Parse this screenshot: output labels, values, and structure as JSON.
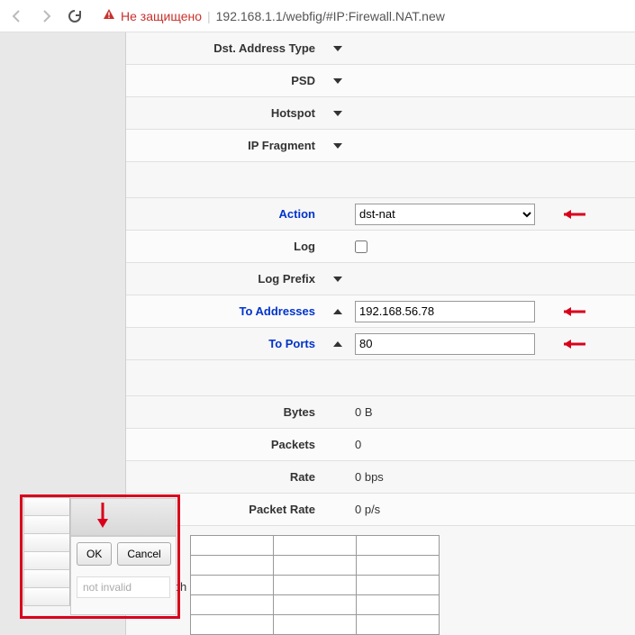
{
  "browser": {
    "security_text": "Не защищено",
    "url": "192.168.1.1/webfig/#IP:Firewall.NAT.new"
  },
  "rows": {
    "dst_addr_type": "Dst. Address Type",
    "psd": "PSD",
    "hotspot": "Hotspot",
    "ip_fragment": "IP Fragment",
    "action": "Action",
    "log": "Log",
    "log_prefix": "Log Prefix",
    "to_addresses": "To Addresses",
    "to_ports": "To Ports",
    "bytes": "Bytes",
    "packets": "Packets",
    "rate": "Rate",
    "packet_rate": "Packet Rate",
    "rate_graph": "Rate Graph"
  },
  "values": {
    "action_selected": "dst-nat",
    "to_addresses": "192.168.56.78",
    "to_ports": "80",
    "bytes": "0 B",
    "packets": "0",
    "rate": "0 bps",
    "packet_rate": "0 p/s"
  },
  "dialog": {
    "ok": "OK",
    "cancel": "Cancel",
    "status": "not invalid"
  }
}
